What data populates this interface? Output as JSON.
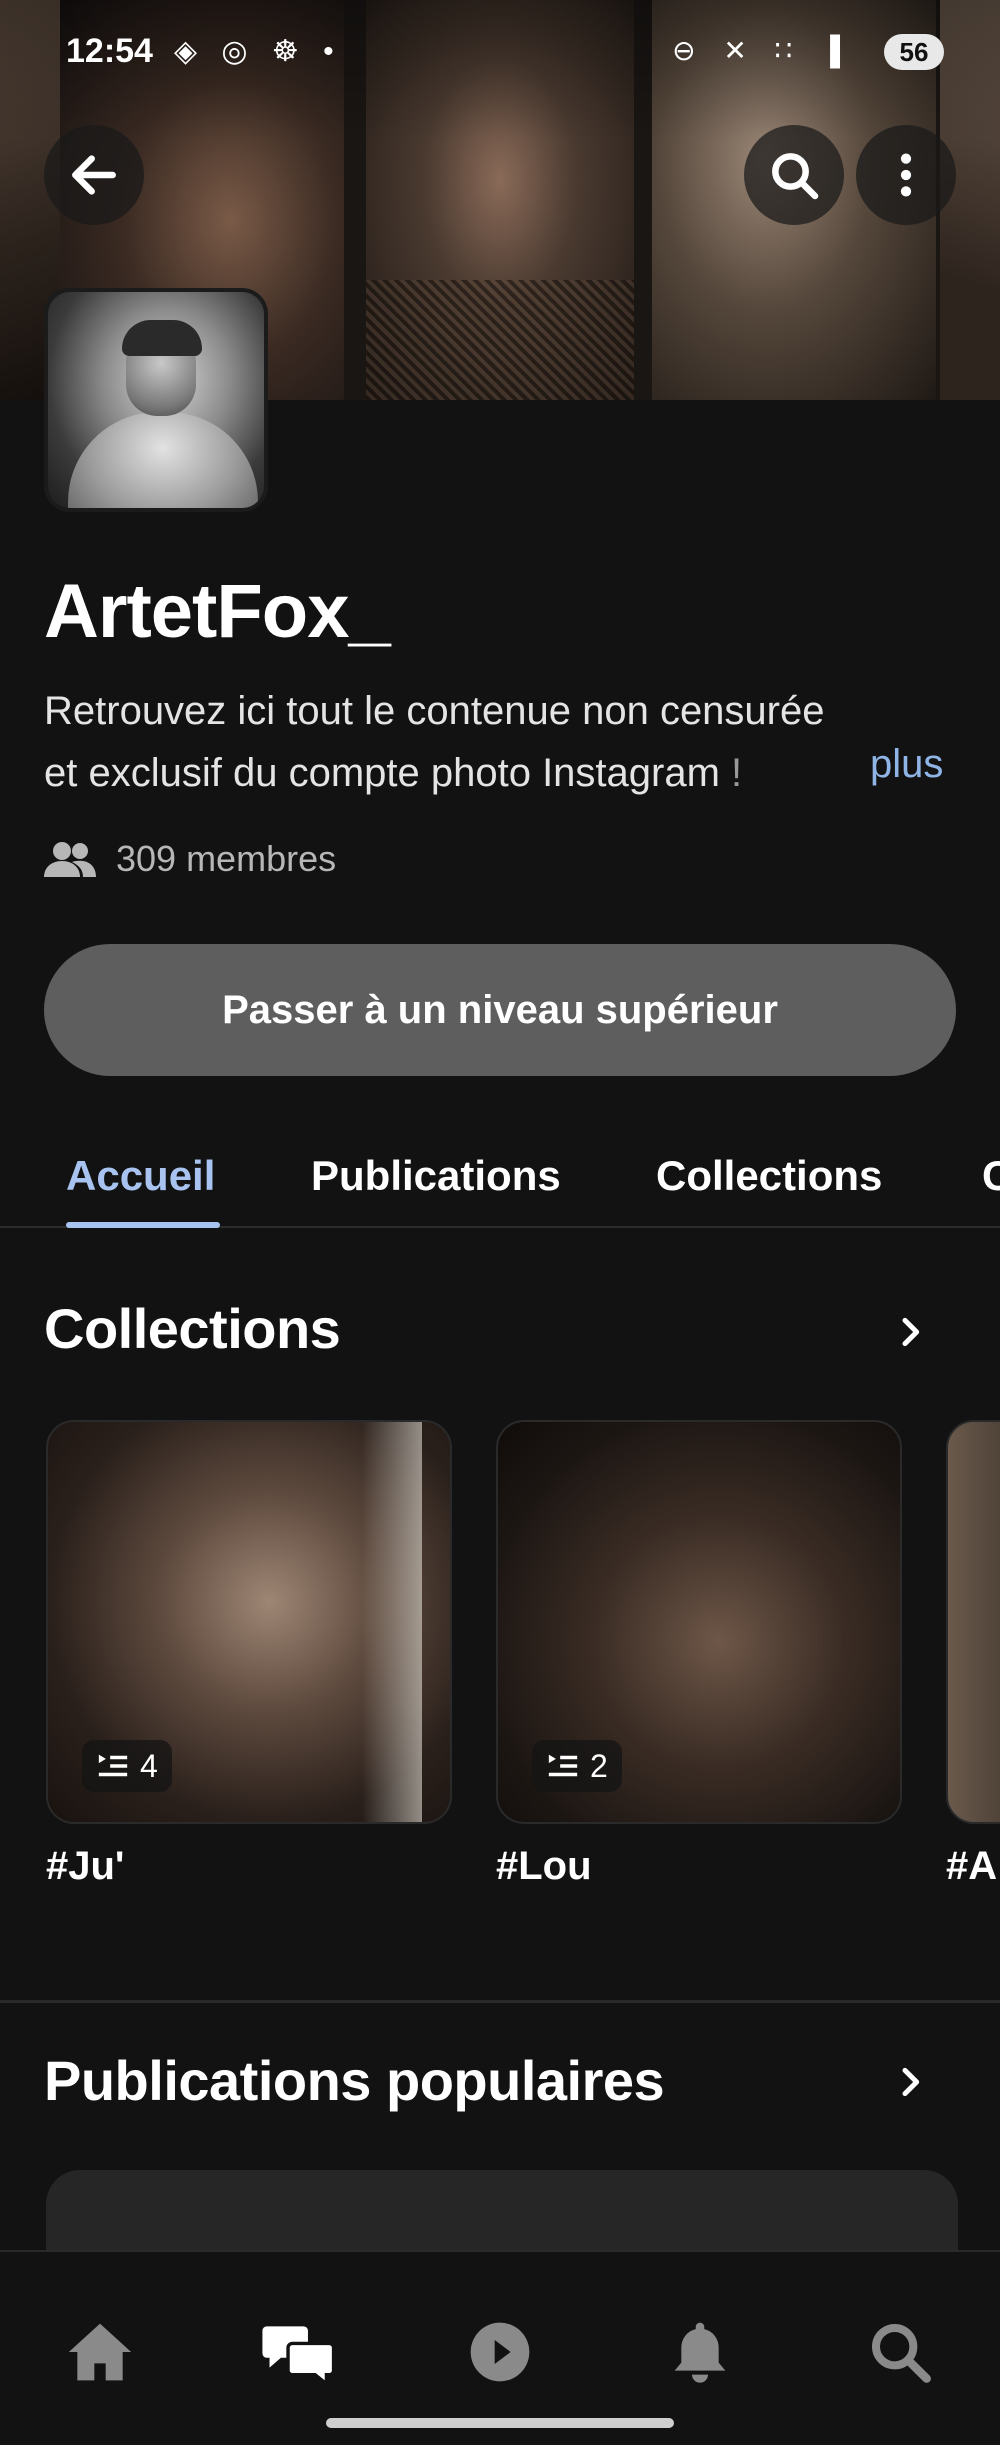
{
  "status_bar": {
    "time": "12:54",
    "left_icons": "◈ ◎ ☸ •",
    "right_icons": "⊖ ✕ ∷ ▐",
    "battery": "56"
  },
  "header": {
    "icons": [
      "back-arrow-icon",
      "search-icon",
      "more-vertical-icon"
    ]
  },
  "profile": {
    "name": "ArtetFox_",
    "description_line1": "Retrouvez ici tout le contenue non censurée",
    "description_line2": "et exclusif du compte photo Instagram",
    "description_fade": " !",
    "more_link": "plus",
    "members": "309 membres",
    "upgrade_button": "Passer à un niveau supérieur"
  },
  "tabs": [
    {
      "label": "Accueil",
      "active": true
    },
    {
      "label": "Publications",
      "active": false
    },
    {
      "label": "Collections",
      "active": false
    },
    {
      "label": "C",
      "active": false
    }
  ],
  "collections_section": {
    "title": "Collections",
    "items": [
      {
        "label": "#Ju'",
        "count": "4"
      },
      {
        "label": "#Lou",
        "count": "2"
      },
      {
        "label": "#A",
        "count": ""
      }
    ]
  },
  "popular_section": {
    "title": "Publications populaires"
  },
  "bottom_nav": [
    "home-icon",
    "chat-icon",
    "play-icon",
    "bell-icon",
    "search-icon"
  ],
  "colors": {
    "background": "#121212",
    "accent": "#a8c3ef",
    "link": "#8fb4e6",
    "button": "#5e5e5e"
  }
}
